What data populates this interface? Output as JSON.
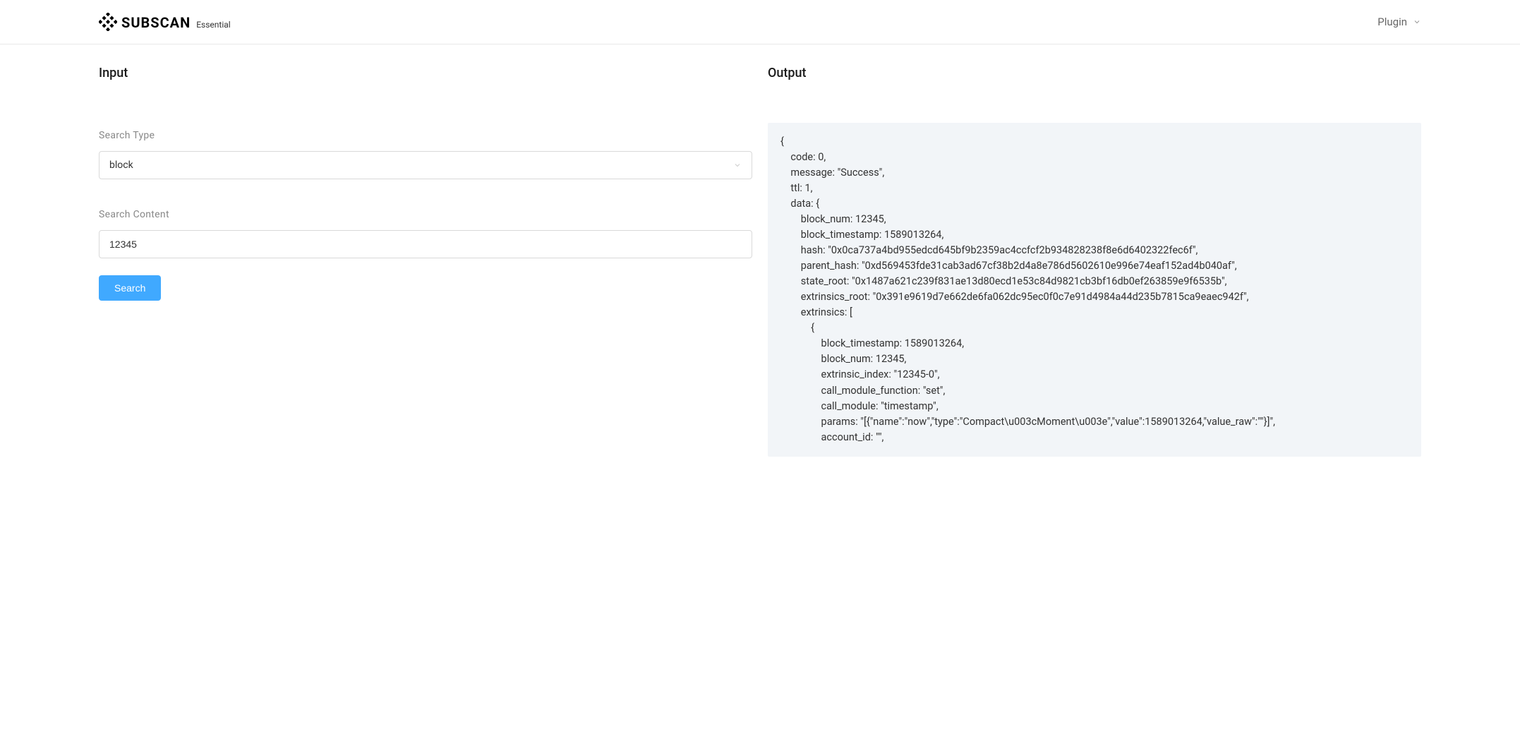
{
  "header": {
    "brand_name": "SUBSCAN",
    "brand_suffix": "Essential",
    "plugin_label": "Plugin"
  },
  "input": {
    "title": "Input",
    "search_type_label": "Search Type",
    "search_type_value": "block",
    "search_content_label": "Search Content",
    "search_content_value": "12345",
    "search_button_label": "Search"
  },
  "output": {
    "title": "Output",
    "code": "{\n    code: 0,\n    message: \"Success\",\n    ttl: 1,\n    data: {\n        block_num: 12345,\n        block_timestamp: 1589013264,\n        hash: \"0x0ca737a4bd955edcd645bf9b2359ac4ccfcf2b934828238f8e6d6402322fec6f\",\n        parent_hash: \"0xd569453fde31cab3ad67cf38b2d4a8e786d5602610e996e74eaf152ad4b040af\",\n        state_root: \"0x1487a621c239f831ae13d80ecd1e53c84d9821cb3bf16db0ef263859e9f6535b\",\n        extrinsics_root: \"0x391e9619d7e662de6fa062dc95ec0f0c7e91d4984a44d235b7815ca9eaec942f\",\n        extrinsics: [\n            {\n                block_timestamp: 1589013264,\n                block_num: 12345,\n                extrinsic_index: \"12345-0\",\n                call_module_function: \"set\",\n                call_module: \"timestamp\",\n                params: \"[{\"name\":\"now\",\"type\":\"Compact\\u003cMoment\\u003e\",\"value\":1589013264,\"value_raw\":\"\"}]\",\n                account_id: \"\","
  }
}
